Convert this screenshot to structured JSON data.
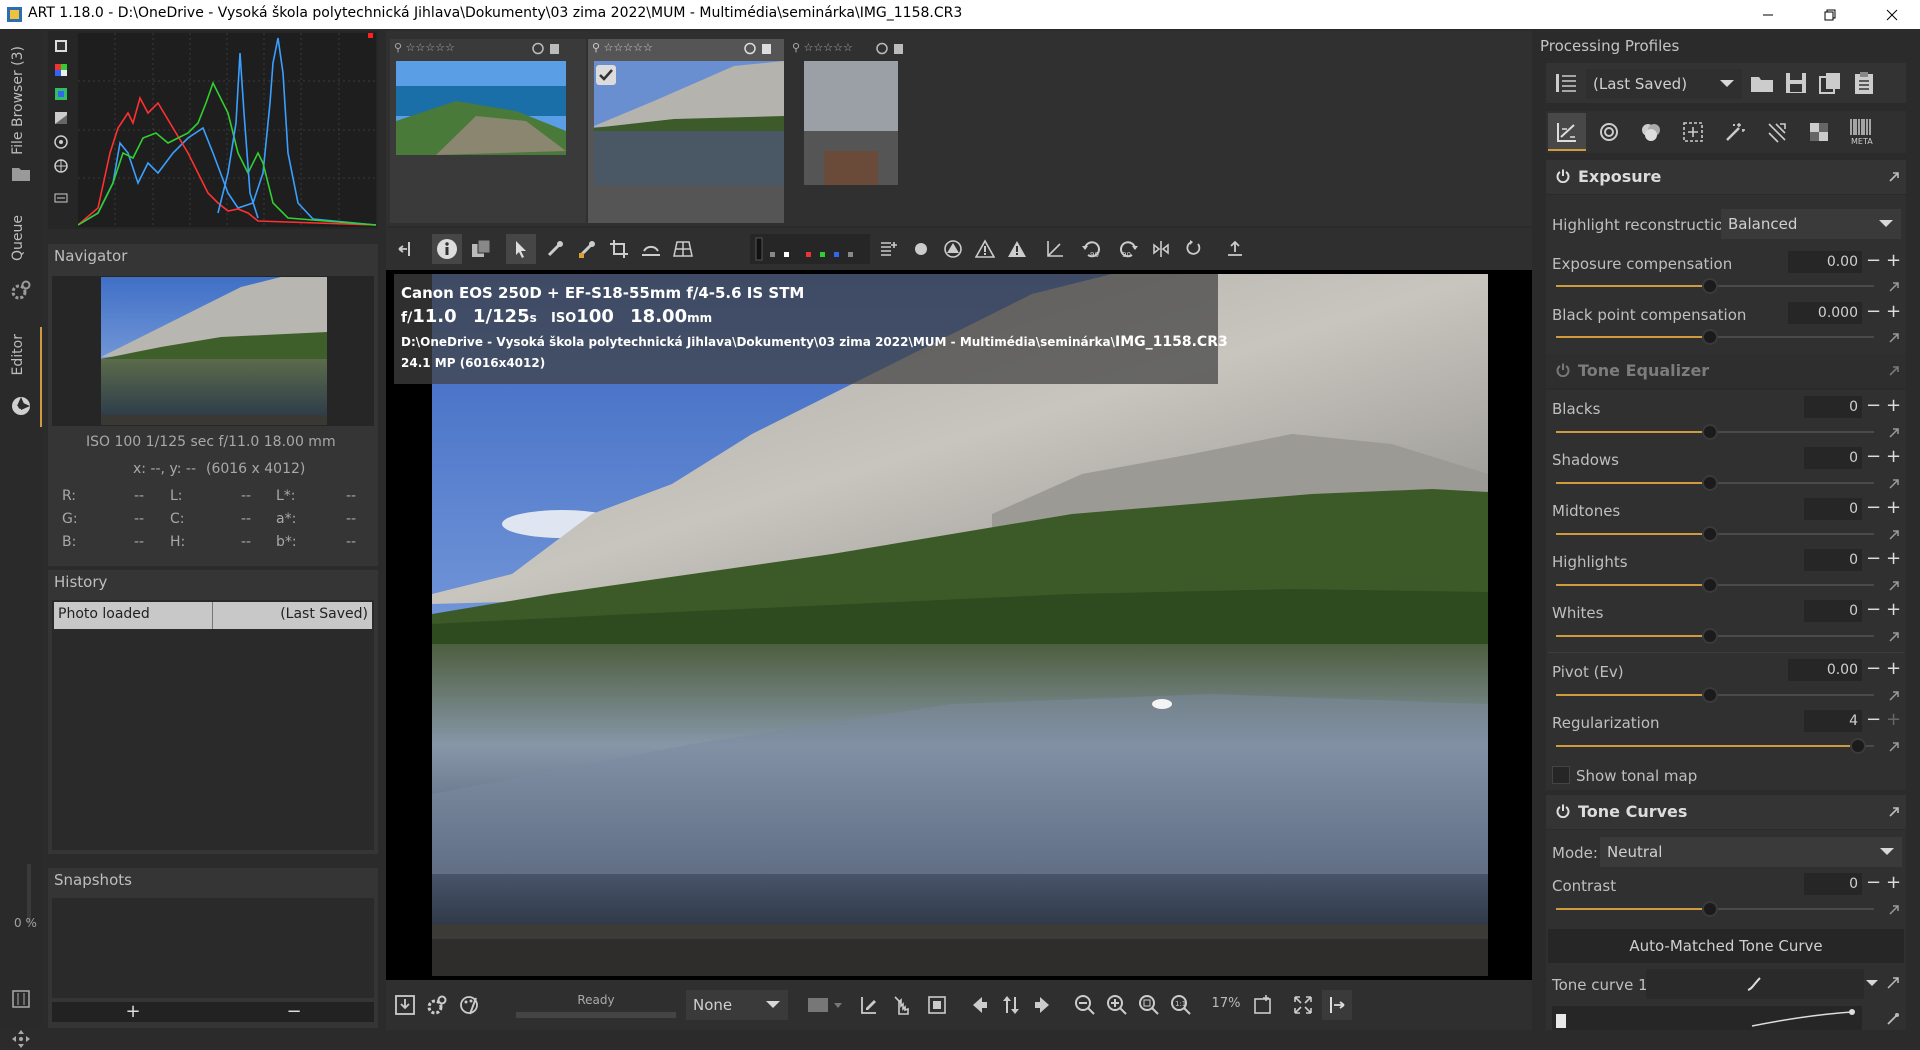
{
  "window": {
    "title": "ART 1.18.0 - D:\\OneDrive - Vysoká škola polytechnická Jihlava\\Dokumenty\\03 zima 2022\\MUM - Multimédia\\seminárka\\IMG_1158.CR3"
  },
  "left_strip": {
    "tabs": [
      "File Browser (3)",
      "Queue",
      "Editor"
    ],
    "progress": "0 %"
  },
  "navigator": {
    "title": "Navigator",
    "exif": "ISO 100   1/125 sec   f/11.0   18.00 mm",
    "coords": "x: --, y: --",
    "size": "(6016 x 4012)",
    "readouts": [
      {
        "label": "R:",
        "value": "--"
      },
      {
        "label": "L:",
        "value": "--"
      },
      {
        "label": "L*:",
        "value": "--"
      },
      {
        "label": "G:",
        "value": "--"
      },
      {
        "label": "C:",
        "value": "--"
      },
      {
        "label": "a*:",
        "value": "--"
      },
      {
        "label": "B:",
        "value": "--"
      },
      {
        "label": "H:",
        "value": "--"
      },
      {
        "label": "b*:",
        "value": "--"
      }
    ]
  },
  "history": {
    "title": "History",
    "rows": [
      {
        "action": "Photo loaded",
        "state": "(Last Saved)"
      }
    ]
  },
  "snapshots": {
    "title": "Snapshots",
    "add": "+",
    "remove": "−"
  },
  "viewer": {
    "overlay": {
      "camera": "Canon EOS 250D + EF-S18-55mm f/4-5.6 IS STM",
      "f": "f/",
      "aperture": "11.0",
      "shutter": "1/125",
      "s": "s",
      "iso_label": "ISO",
      "iso": "100",
      "focal": "18.00",
      "mm": "mm",
      "path": "D:\\OneDrive - Vysoká škola polytechnická Jihlava\\Dokumenty\\03 zima 2022\\MUM - Multimédia\\seminárka\\",
      "filename": "IMG_1158.CR3",
      "resolution": "24.1 MP (6016x4012)"
    }
  },
  "bottombar": {
    "status": "Ready",
    "preview_mode": "None",
    "zoom": "17%"
  },
  "right": {
    "profiles_title": "Processing Profiles",
    "profile": "(Last Saved)",
    "meta_label": "META",
    "exposure": {
      "title": "Exposure",
      "highlight_label": "Highlight reconstruction:",
      "highlight_value": "Balanced",
      "comp_label": "Exposure compensation",
      "comp_value": "0.00",
      "black_label": "Black point compensation",
      "black_value": "0.000"
    },
    "tone_eq": {
      "title": "Tone Equalizer",
      "bands": [
        {
          "label": "Blacks",
          "value": "0"
        },
        {
          "label": "Shadows",
          "value": "0"
        },
        {
          "label": "Midtones",
          "value": "0"
        },
        {
          "label": "Highlights",
          "value": "0"
        },
        {
          "label": "Whites",
          "value": "0"
        }
      ],
      "pivot_label": "Pivot (Ev)",
      "pivot_value": "0.00",
      "reg_label": "Regularization",
      "reg_value": "4",
      "tonal_map": "Show tonal map"
    },
    "tone_curves": {
      "title": "Tone Curves",
      "mode_label": "Mode:",
      "mode_value": "Neutral",
      "contrast_label": "Contrast",
      "contrast_value": "0",
      "auto_button": "Auto-Matched Tone Curve",
      "curve_label": "Tone curve 1:"
    }
  },
  "colors": {
    "accent": "#d09b3e",
    "panel": "#353535",
    "background": "#2b2b2b"
  }
}
